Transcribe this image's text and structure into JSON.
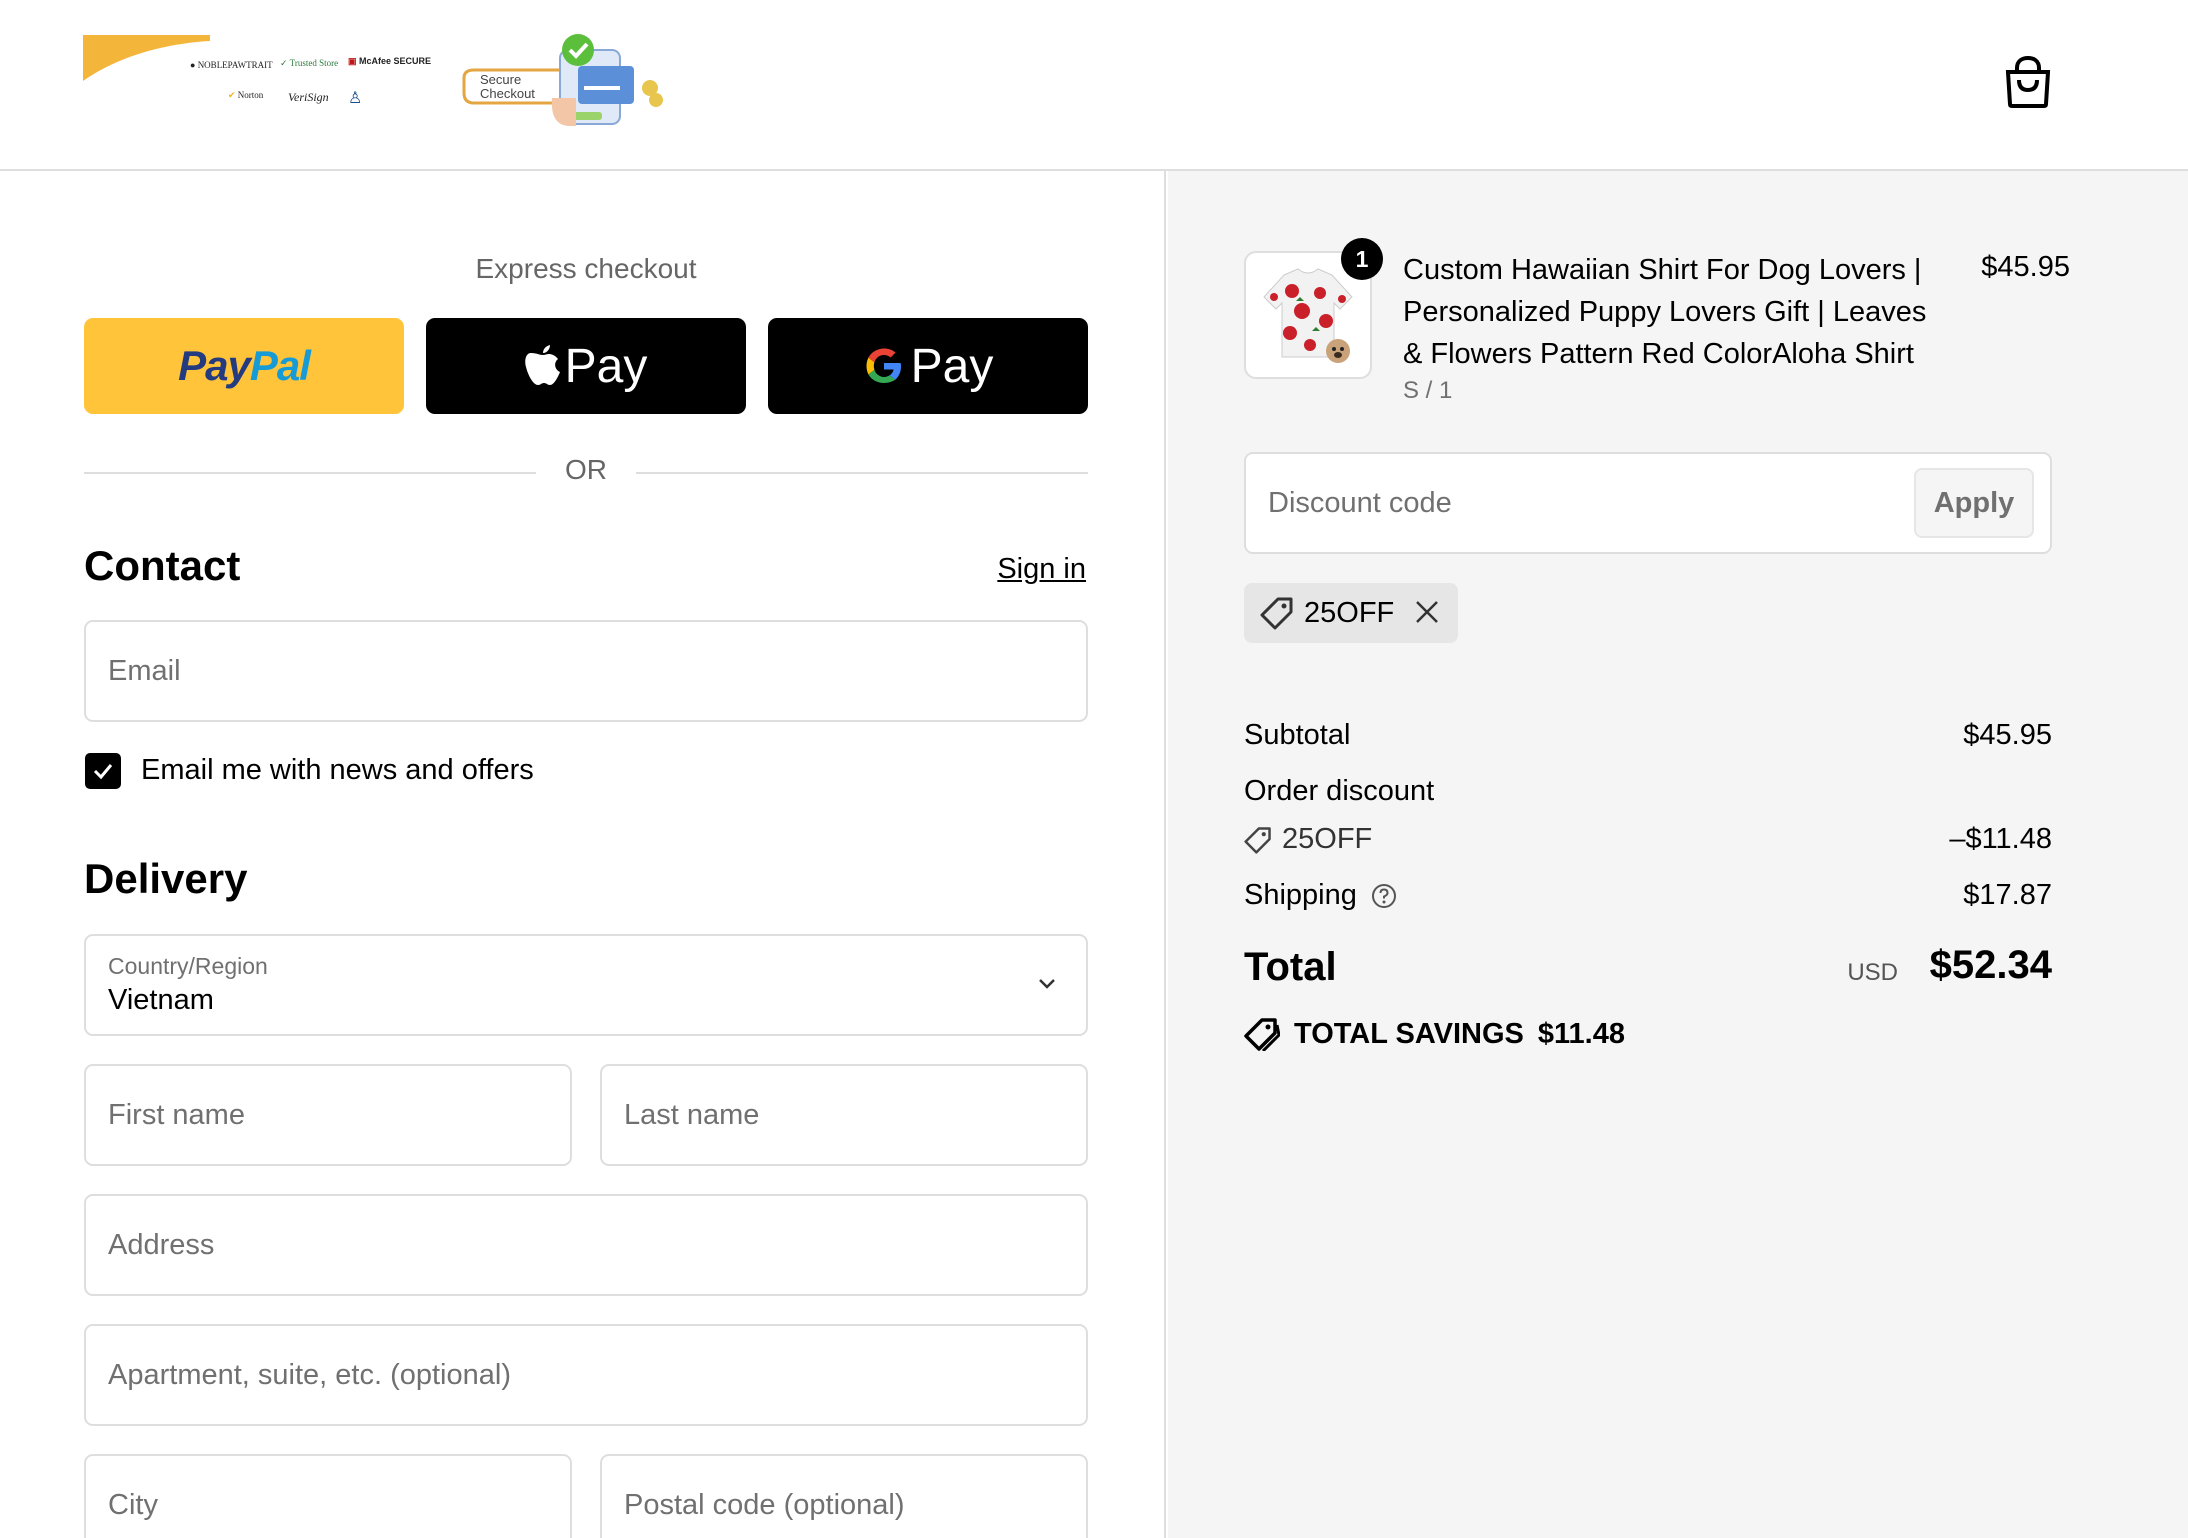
{
  "header": {
    "badges": [
      "NOBLEPAWTRAIT",
      "Trusted Store",
      "McAfee SECURE",
      "Norton",
      "VeriSign"
    ],
    "secure_checkout_text": [
      "Secure",
      "Checkout"
    ]
  },
  "express": {
    "title": "Express checkout",
    "paypal_part1": "Pay",
    "paypal_part2": "Pal",
    "apple_pay": "Pay",
    "google_pay": "Pay",
    "or": "OR"
  },
  "contact": {
    "title": "Contact",
    "sign_in": "Sign in",
    "email_placeholder": "Email",
    "newsletter_label": "Email me with news and offers",
    "newsletter_checked": true
  },
  "delivery": {
    "title": "Delivery",
    "country_label": "Country/Region",
    "country_value": "Vietnam",
    "first_name": "First name",
    "last_name": "Last name",
    "address": "Address",
    "apartment": "Apartment, suite, etc. (optional)",
    "city": "City",
    "postal": "Postal code (optional)"
  },
  "order": {
    "product": {
      "quantity": "1",
      "title": "Custom Hawaiian Shirt For Dog Lovers | Personalized Puppy Lovers Gift | Leaves & Flowers Pattern Red ColorAloha Shirt",
      "variant": "S / 1",
      "price": "$45.95"
    },
    "discount_placeholder": "Discount code",
    "apply": "Apply",
    "applied_code": "25OFF",
    "subtotal_label": "Subtotal",
    "subtotal_value": "$45.95",
    "order_discount_label": "Order discount",
    "discount_code": "25OFF",
    "discount_value": "–$11.48",
    "shipping_label": "Shipping",
    "shipping_value": "$17.87",
    "total_label": "Total",
    "currency": "USD",
    "total_value": "$52.34",
    "savings_label": "TOTAL SAVINGS",
    "savings_value": "$11.48"
  },
  "colors": {
    "paypal_yellow": "#ffc439",
    "paypal_dark_blue": "#253b80",
    "paypal_light_blue": "#179bd7",
    "border": "#dedede",
    "summary_bg": "#f5f5f5"
  }
}
